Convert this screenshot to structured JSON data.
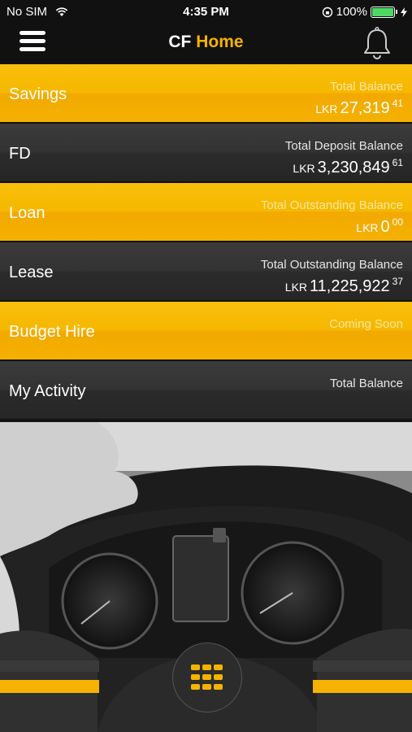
{
  "status": {
    "carrier": "No SIM",
    "time": "4:35 PM",
    "battery": "100%"
  },
  "header": {
    "title_prefix": "CF",
    "title_main": "Home"
  },
  "rows": [
    {
      "name": "Savings",
      "label": "Total Balance",
      "currency": "LKR",
      "amount": "27,319",
      "decimal": "41"
    },
    {
      "name": "FD",
      "label": "Total Deposit Balance",
      "currency": "LKR",
      "amount": "3,230,849",
      "decimal": "61"
    },
    {
      "name": "Loan",
      "label": "Total Outstanding Balance",
      "currency": "LKR",
      "amount": "0",
      "decimal": "00"
    },
    {
      "name": "Lease",
      "label": "Total Outstanding Balance",
      "currency": "LKR",
      "amount": "11,225,922",
      "decimal": "37"
    },
    {
      "name": "Budget Hire",
      "label": "Coming Soon"
    },
    {
      "name": "My Activity",
      "label": "Total Balance"
    }
  ],
  "colors": {
    "accent": "#f5b300",
    "dark_row": "#2f2f2f",
    "background": "#111111"
  },
  "icons": [
    "hamburger-menu-icon",
    "bell-icon",
    "wifi-icon",
    "grid-menu-icon"
  ]
}
